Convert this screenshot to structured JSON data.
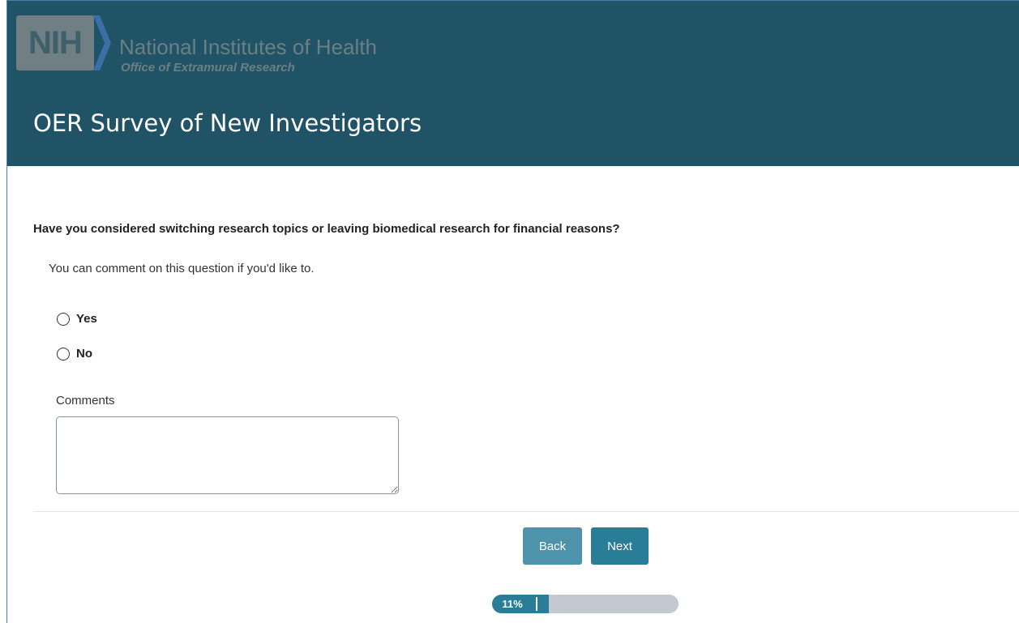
{
  "header": {
    "logo_text": "NIH",
    "org_name": "National Institutes of Health",
    "org_subtitle": "Office of Extramural Research",
    "survey_title": "OER Survey of New Investigators",
    "colors": {
      "banner": "#1f5365",
      "logo": "#707f84",
      "chevron": "#3c6ea8"
    }
  },
  "question": {
    "text": "Have you considered switching research topics or leaving biomedical research for financial reasons?",
    "help_text": "You can comment on this question if you'd like to.",
    "options": [
      {
        "label": "Yes",
        "selected": false
      },
      {
        "label": "No",
        "selected": false
      }
    ],
    "comments_label": "Comments",
    "comments_value": ""
  },
  "navigation": {
    "back_label": "Back",
    "next_label": "Next",
    "colors": {
      "back": "#4e93ac",
      "next": "#2a7d96"
    }
  },
  "progress": {
    "percent": 11,
    "label": "11%"
  }
}
